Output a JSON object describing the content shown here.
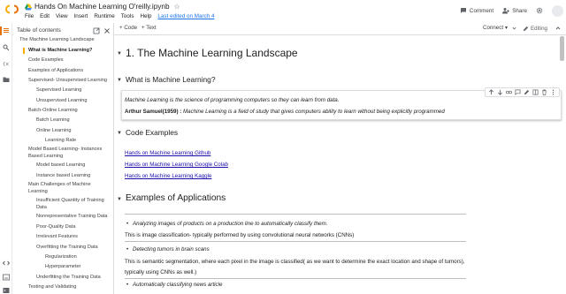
{
  "app": {
    "notebook_title": "Hands On Machine Learning O'reilly.ipynb",
    "menu": [
      "File",
      "Edit",
      "View",
      "Insert",
      "Runtime",
      "Tools",
      "Help"
    ],
    "last_edited": "Last edited on March 4"
  },
  "header_right": {
    "comment_label": "Comment",
    "share_label": "Share"
  },
  "toolbar": {
    "add_code": "+ Code",
    "add_text": "+ Text",
    "connect": "Connect",
    "editing": "Editing"
  },
  "toc": {
    "title": "Table of contents",
    "items": [
      "The Machine Learning Landscape",
      "What is Machine Learning?",
      "Code Examples",
      "Examples of Applications",
      "Supervised- Unsupervised Learning",
      "Supervised Learning",
      "Unsupervised Learning",
      "Batch-Online Learning",
      "Batch Learning",
      "Online Learning",
      "Learning Rate",
      "Model Based Learning- Instances Based Learning",
      "Model based Learning",
      "Instance based Learning",
      "Main Challenges of Machine Learning",
      "Insufficient Quantity of Training Data",
      "Nonrepresentative Training Data",
      "Poor-Quality Data",
      "Irrelevant Features",
      "Overfitting the Training Data",
      "Regularization",
      "Hyperparameter",
      "Underfitting the Training Data",
      "Testing and Validating"
    ]
  },
  "content": {
    "h1": "1. The Machine Learning Landscape",
    "what_is_ml": "What is Machine Learning?",
    "cell_line1": "Machine Learning is the science of programming computers so they can learn from data.",
    "cell_line2_bold": "Arthur Samuel(1959) :",
    "cell_line2_rest": " Machine Learning is a field of study that gives computers ability to learn without being explicitly programmed",
    "code_examples": "Code Examples",
    "links": [
      "Hands on Machine Learning Github",
      "Hands on Machine Learning Google Colab",
      "Hands on Machine Learning Kaggle"
    ],
    "examples_heading": "Examples of Applications",
    "bullet1": "Analyzing images of products on a production line to automatically classify them.",
    "para1": "This is image classification- typically performed by using convolutional neural networks (CNNs)",
    "bullet2": "Detecting tumors in brain scans",
    "para2a": "This is semantic segmentation, where each pixel in the image is classified( as we want to determine the exact location and shape of tumors),",
    "para2b": "typically using CNNs as well.)",
    "bullet3": "Automatically classifying news article"
  }
}
